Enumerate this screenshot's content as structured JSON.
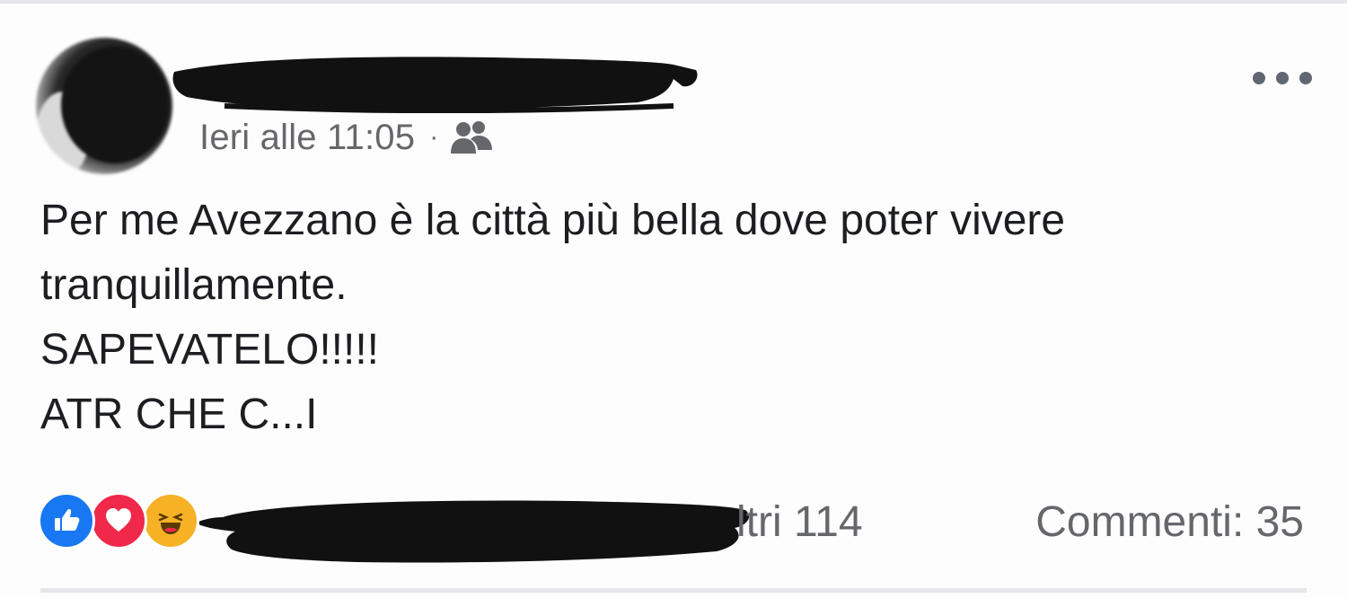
{
  "post": {
    "timestamp": "Ieri alle 11:05",
    "separator": "·",
    "audience_icon": "friends-icon",
    "author_redacted": true,
    "more_icon": "more-options-icon",
    "body_lines": [
      "Per me Avezzano è la città più bella dove poter vivere",
      "tranquillamente.",
      "SAPEVATELO!!!!!",
      "ATR CHE C...I"
    ]
  },
  "footer": {
    "reactions": [
      "like-icon",
      "love-icon",
      "haha-icon"
    ],
    "reactors_visible_tail": "ltri 114",
    "comments_label": "Commenti: 35"
  },
  "colors": {
    "like": "#1877f2",
    "love": "#f0284a",
    "haha": "#f7b125",
    "meta_text": "#65676b",
    "body_text": "#1c1e21"
  }
}
